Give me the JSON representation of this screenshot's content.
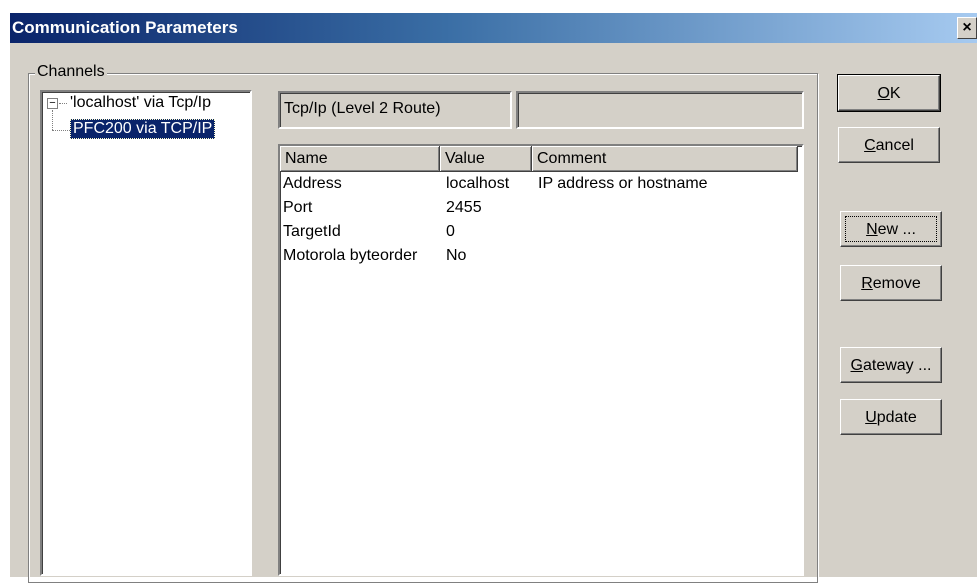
{
  "window": {
    "title": "Communication Parameters",
    "close_glyph": "×"
  },
  "channels": {
    "group_label": "Channels",
    "items": [
      {
        "label": "'localhost' via Tcp/Ip",
        "expanded": true,
        "selected": false
      },
      {
        "label": "PFC200 via TCP/IP",
        "selected": true
      }
    ]
  },
  "driver_name": "Tcp/Ip (Level 2 Route)",
  "driver_extra": "",
  "parameters": {
    "columns": [
      "Name",
      "Value",
      "Comment"
    ],
    "rows": [
      [
        "Address",
        "localhost",
        "IP address or hostname"
      ],
      [
        "Port",
        "2455",
        ""
      ],
      [
        "TargetId",
        "0",
        ""
      ],
      [
        "Motorola byteorder",
        "No",
        ""
      ]
    ]
  },
  "buttons": {
    "ok": "OK",
    "cancel": "Cancel",
    "new": "New ...",
    "remove": "Remove",
    "gateway": "Gateway ...",
    "update": "Update"
  }
}
